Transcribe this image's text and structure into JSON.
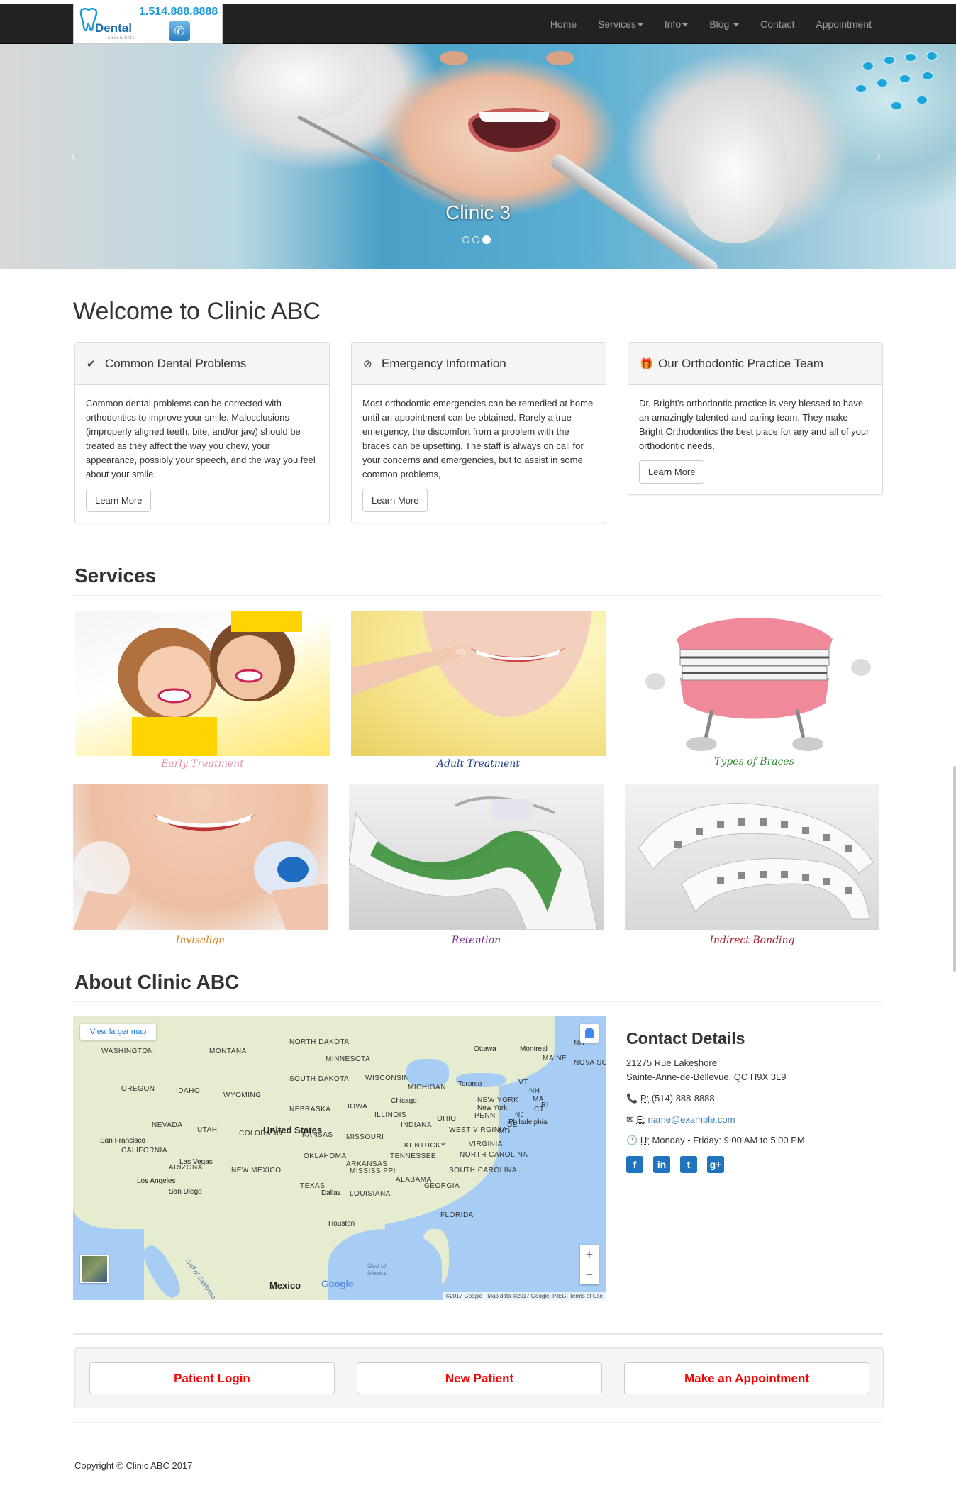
{
  "logo": {
    "brand": "Dental",
    "brand_sub": "specialists",
    "phone": "1.514.888.8888"
  },
  "nav": {
    "items": [
      {
        "label": "Home",
        "dropdown": false
      },
      {
        "label": "Services",
        "dropdown": true
      },
      {
        "label": "Info",
        "dropdown": true
      },
      {
        "label": "Blog",
        "dropdown": true
      },
      {
        "label": "Contact",
        "dropdown": false
      },
      {
        "label": "Appointment",
        "dropdown": false
      }
    ]
  },
  "carousel": {
    "caption": "Clinic 3",
    "prev": "‹",
    "next": "›",
    "slide_count": 3,
    "active_index": 2
  },
  "welcome": {
    "title": "Welcome to Clinic ABC",
    "panels": [
      {
        "icon": "check-icon",
        "title": "Common Dental Problems",
        "body": "Common dental problems can be corrected with orthodontics to improve your smile. Malocclusions (improperly aligned teeth, bite, and/or jaw) should be treated as they affect the way you chew, your appearance, possibly your speech, and the way you feel about your smile.",
        "button": "Learn More"
      },
      {
        "icon": "compass-icon",
        "title": "Emergency Information",
        "body": "Most orthodontic emergencies can be remedied at home until an appointment can be obtained. Rarely a true emergency, the discomfort from a problem with the braces can be upsetting. The staff is always on call for your concerns and emergencies, but to assist in some common problems,",
        "button": "Learn More"
      },
      {
        "icon": "gift-icon",
        "title": "Our Orthodontic Practice Team",
        "body": "Dr. Bright's orthodontic practice is very blessed to have an amazingly talented and caring team. They make Bright Orthodontics the best place for any and all of your orthodontic needs.",
        "button": "Learn More"
      }
    ]
  },
  "services": {
    "title": "Services",
    "items": [
      {
        "caption": "Early Treatment",
        "color": "#e88fb0"
      },
      {
        "caption": "Adult Treatment",
        "color": "#1f3d8a"
      },
      {
        "caption": "Types of Braces",
        "color": "#2a8a2a"
      },
      {
        "caption": "Invisalign",
        "color": "#e0801a"
      },
      {
        "caption": "Retention",
        "color": "#7a2f8a"
      },
      {
        "caption": "Indirect Bonding",
        "color": "#b01e2a"
      }
    ]
  },
  "about": {
    "title": "About Clinic ABC",
    "map": {
      "view_larger": "View larger map",
      "zoom_in": "+",
      "zoom_out": "−",
      "google": "Google",
      "attribution": "©2017 Google · Map data ©2017 Google, INEGI   Terms of Use",
      "gulf_of_california": "Gulf of California",
      "gulf_of_mexico": "Gulf of Mexico",
      "country_us": "United States",
      "country_mexico": "Mexico",
      "states": [
        "WASHINGTON",
        "MONTANA",
        "NORTH DAKOTA",
        "MINNESOTA",
        "OREGON",
        "IDAHO",
        "SOUTH DAKOTA",
        "WYOMING",
        "WISCONSIN",
        "MICHIGAN",
        "IOWA",
        "NEBRASKA",
        "ILLINOIS",
        "INDIANA",
        "OHIO",
        "PENN",
        "NEVADA",
        "UTAH",
        "COLORADO",
        "KANSAS",
        "MISSOURI",
        "KENTUCKY",
        "WEST VIRGINIA",
        "VIRGINIA",
        "CALIFORNIA",
        "ARIZONA",
        "NEW MEXICO",
        "OKLAHOMA",
        "ARKANSAS",
        "TENNESSEE",
        "NORTH CAROLINA",
        "SOUTH CAROLINA",
        "MISSISSIPPI",
        "ALABAMA",
        "GEORGIA",
        "TEXAS",
        "LOUISIANA",
        "FLORIDA",
        "MAINE",
        "NB",
        "NOVA SC",
        "NEW YORK",
        "VT",
        "NH",
        "MA",
        "CT",
        "RI",
        "MD",
        "DE",
        "NJ"
      ],
      "cities": [
        "Ottawa",
        "Montreal",
        "Toronto",
        "Chicago",
        "New York",
        "Philadelphia",
        "San Francisco",
        "Las Vegas",
        "Los Angeles",
        "San Diego",
        "Dallas",
        "Houston"
      ]
    },
    "contact": {
      "title": "Contact Details",
      "address1": "21275 Rue Lakeshore",
      "address2": "Sainte-Anne-de-Bellevue, QC H9X 3L9",
      "phone_key": "P:",
      "phone": "(514) 888-8888",
      "email_key": "E:",
      "email": "name@example.com",
      "hours_key": "H:",
      "hours": "Monday - Friday: 9:00 AM to 5:00 PM",
      "socials": [
        "facebook-icon",
        "linkedin-icon",
        "twitter-icon",
        "google-plus-icon"
      ],
      "social_glyphs": [
        "f",
        "in",
        "t",
        "g+"
      ]
    }
  },
  "cta": {
    "buttons": [
      "Patient Login",
      "New Patient",
      "Make an Appointment"
    ]
  },
  "footer": {
    "copyright": "Copyright © Clinic ABC 2017"
  }
}
